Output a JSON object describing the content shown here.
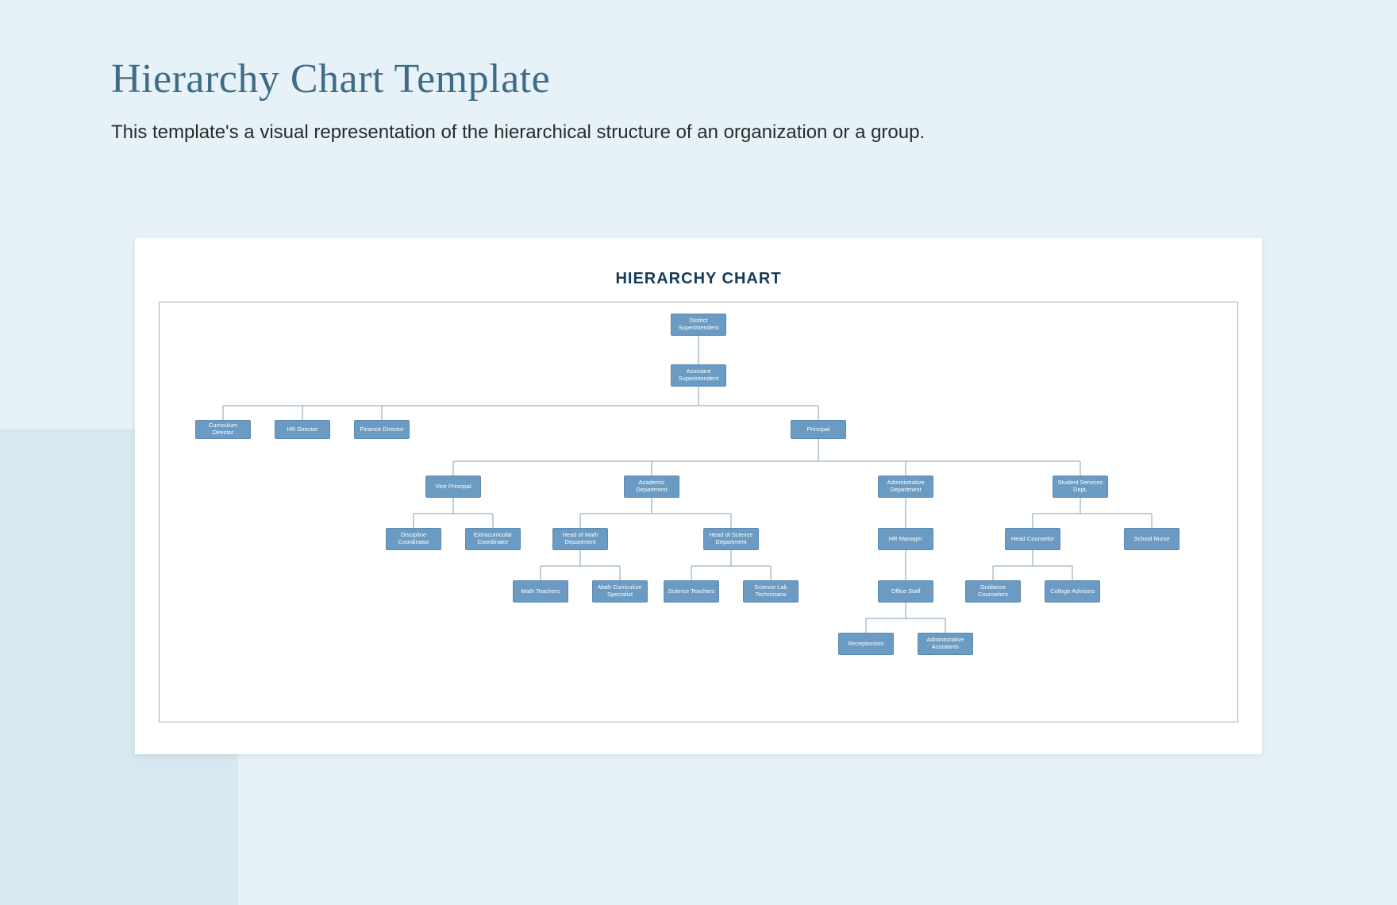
{
  "header": {
    "title": "Hierarchy Chart Template",
    "subtitle": "This template's a visual representation of the hierarchical structure of an organization or a group."
  },
  "chart": {
    "heading": "HIERARCHY CHART",
    "nodes": {
      "district_superintendent": "District Superintendent",
      "assistant_superintendent": "Assistant Superintendent",
      "curriculum_director": "Curriculum Director",
      "hr_director": "HR Director",
      "finance_director": "Finance Director",
      "principal": "Principal",
      "vice_principal": "Vice Principal",
      "academic_department": "Academic Department",
      "administrative_department": "Administrative Department",
      "student_services_dept": "Student Services Dept.",
      "discipline_coordinator": "Discipline Coordinator",
      "extracurricular_coordinator": "Extracurricular Coordinator",
      "head_of_math_department": "Head of Math Department",
      "head_of_science_department": "Head of Science Department",
      "hr_manager": "HR Manager",
      "head_counselor": "Head Counselor",
      "school_nurse": "School Nurse",
      "math_teachers": "Math Teachers",
      "math_curriculum_specialist": "Math Curriculum Specialist",
      "science_teachers": "Science Teachers",
      "science_lab_technicians": "Science Lab Technicians",
      "office_staff": "Office Staff",
      "guidance_counselors": "Guidance Counselors",
      "college_advisors": "College Advisors",
      "receptionists": "Receptionists",
      "administrative_assistants": "Administrative Assistants"
    }
  },
  "colors": {
    "page_bg": "#e6f2f8",
    "node_fill": "#6b9bc3",
    "title_color": "#3e6b86",
    "chart_title_color": "#143a5a"
  }
}
